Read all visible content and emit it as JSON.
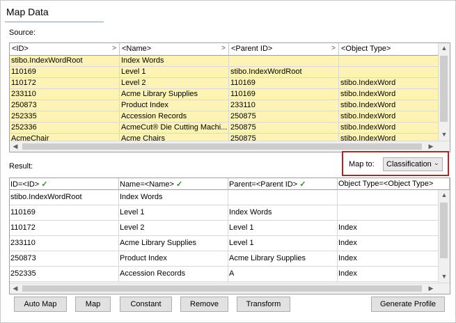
{
  "title": "Map Data",
  "source": {
    "label": "Source:",
    "columns": [
      "<ID>",
      "<Name>",
      "<Parent ID>",
      "<Object Type>"
    ],
    "rows": [
      [
        "stibo.IndexWordRoot",
        "Index Words",
        "",
        ""
      ],
      [
        "110169",
        "Level 1",
        "stibo.IndexWordRoot",
        ""
      ],
      [
        "110172",
        "Level 2",
        "110169",
        "stibo.IndexWord"
      ],
      [
        "233110",
        "Acme Library Supplies",
        "110169",
        "stibo.IndexWord"
      ],
      [
        "250873",
        "Product Index",
        "233110",
        "stibo.IndexWord"
      ],
      [
        "252335",
        "Accession Records",
        "250875",
        "stibo.IndexWord"
      ],
      [
        "252336",
        "AcmeCut® Die Cutting Machi...",
        "250875",
        "stibo.IndexWord"
      ],
      [
        "AcmeChair",
        "Acme Chairs",
        "250875",
        "stibo.IndexWord"
      ]
    ]
  },
  "map_to": {
    "label": "Map to:",
    "value": "Classification"
  },
  "result": {
    "label": "Result:",
    "columns": [
      {
        "label": "ID=<ID>",
        "mapped": true
      },
      {
        "label": "Name=<Name>",
        "mapped": true
      },
      {
        "label": "Parent=<Parent ID>",
        "mapped": true
      },
      {
        "label": "Object Type=<Object Type>",
        "mapped": false
      }
    ],
    "rows": [
      [
        "stibo.IndexWordRoot",
        "Index Words",
        "",
        ""
      ],
      [
        "110169",
        "Level 1",
        "Index Words",
        ""
      ],
      [
        "110172",
        "Level 2",
        "Level 1",
        "Index"
      ],
      [
        "233110",
        "Acme Library Supplies",
        "Level 1",
        "Index"
      ],
      [
        "250873",
        "Product Index",
        "Acme Library Supplies",
        "Index"
      ],
      [
        "252335",
        "Accession Records",
        "A",
        "Index"
      ]
    ]
  },
  "buttons": {
    "auto_map": "Auto Map",
    "map": "Map",
    "constant": "Constant",
    "remove": "Remove",
    "transform": "Transform",
    "generate_profile": "Generate Profile"
  },
  "icons": {
    "sort": "chevron-right-icon",
    "check": "checkmark-icon",
    "dropdown": "chevron-down-icon"
  }
}
